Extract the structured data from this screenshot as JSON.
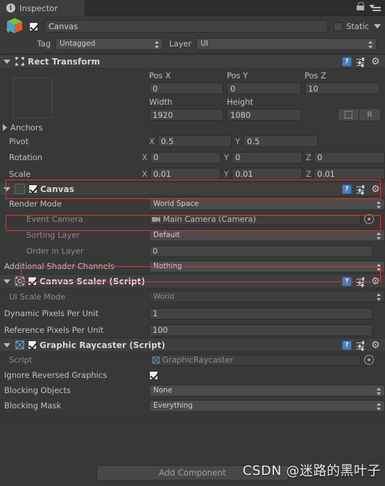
{
  "window": {
    "tab_label": "Inspector",
    "info_icon": "info-icon",
    "lock_icon": "lock-icon",
    "menu_icon": "hamburger-menu-icon"
  },
  "gameobject": {
    "icon": "cube-icon",
    "enabled": true,
    "name": "Canvas",
    "static_label": "Static",
    "static_checked": false,
    "tag_label": "Tag",
    "tag_value": "Untagged",
    "layer_label": "Layer",
    "layer_value": "UI"
  },
  "components": [
    {
      "id": "rect-transform",
      "title": "Rect Transform",
      "icon": "rect-transform-icon",
      "expanded": true,
      "has_checkbox": false,
      "fields": {
        "pos_x_label": "Pos X",
        "pos_y_label": "Pos Y",
        "pos_z_label": "Pos Z",
        "pos_x": "0",
        "pos_y": "0",
        "pos_z": "10",
        "width_label": "Width",
        "height_label": "Height",
        "width": "1920",
        "height": "1080",
        "blueprint_btn": "blueprint-mode-icon",
        "raw_btn": "R",
        "anchors_label": "Anchors",
        "pivot_label": "Pivot",
        "pivot_x_axis": "X",
        "pivot_x": "0.5",
        "pivot_y_axis": "Y",
        "pivot_y": "0.5",
        "rotation_label": "Rotation",
        "rot_x": "0",
        "rot_y": "0",
        "rot_z": "0",
        "scale_label": "Scale",
        "scale_x": "0.01",
        "scale_y": "0.01",
        "scale_z": "0.01",
        "axis_x": "X",
        "axis_y": "Y",
        "axis_z": "Z"
      }
    },
    {
      "id": "canvas",
      "title": "Canvas",
      "icon": "canvas-icon",
      "expanded": true,
      "has_checkbox": true,
      "checked": true,
      "fields": {
        "render_mode_label": "Render Mode",
        "render_mode_value": "World Space",
        "event_camera_label": "Event Camera",
        "event_camera_value": "Main Camera (Camera)",
        "sorting_layer_label": "Sorting Layer",
        "sorting_layer_value": "Default",
        "order_in_layer_label": "Order in Layer",
        "order_in_layer_value": "0",
        "additional_shader_label": "Additional Shader Channels",
        "additional_shader_value": "Nothing"
      }
    },
    {
      "id": "canvas-scaler",
      "title": "Canvas Scaler (Script)",
      "icon": "canvas-scaler-icon",
      "expanded": true,
      "has_checkbox": true,
      "checked": true,
      "fields": {
        "ui_scale_mode_label": "UI Scale Mode",
        "ui_scale_mode_value": "World",
        "dynamic_ppu_label": "Dynamic Pixels Per Unit",
        "dynamic_ppu_value": "1",
        "reference_ppu_label": "Reference Pixels Per Unit",
        "reference_ppu_value": "100"
      }
    },
    {
      "id": "graphic-raycaster",
      "title": "Graphic Raycaster (Script)",
      "icon": "graphic-raycaster-icon",
      "expanded": true,
      "has_checkbox": true,
      "checked": true,
      "fields": {
        "script_label": "Script",
        "script_value": "GraphicRaycaster",
        "ignore_reversed_label": "Ignore Reversed Graphics",
        "ignore_reversed_checked": true,
        "blocking_objects_label": "Blocking Objects",
        "blocking_objects_value": "None",
        "blocking_mask_label": "Blocking Mask",
        "blocking_mask_value": "Everything"
      }
    }
  ],
  "footer": {
    "add_component_label": "Add Component",
    "watermark": "CSDN @迷路的黑叶子"
  },
  "highlights": {
    "color": "#e8352e",
    "boxes": [
      "scale-row",
      "render-mode-row",
      "order-in-layer-row"
    ]
  }
}
